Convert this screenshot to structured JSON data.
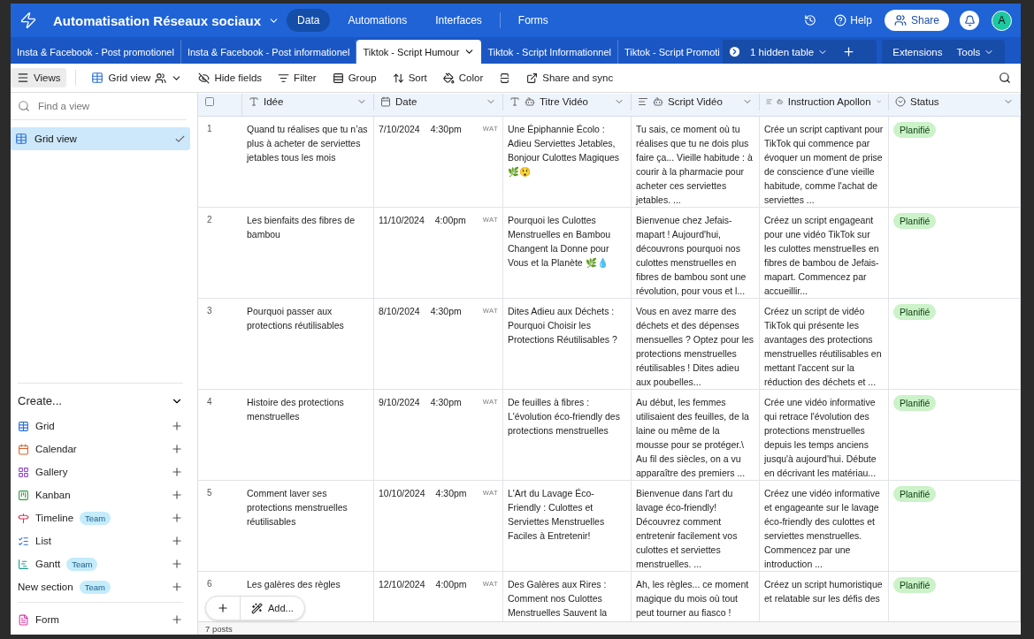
{
  "app": {
    "title": "Automatisation Réseaux sociaux"
  },
  "nav": [
    {
      "label": "Data",
      "selected": true
    },
    {
      "label": "Automations",
      "selected": false
    },
    {
      "label": "Interfaces",
      "selected": false
    },
    {
      "label": "Forms",
      "selected": false
    }
  ],
  "top_actions": {
    "help": "Help",
    "share": "Share",
    "avatar": "A"
  },
  "tables": [
    {
      "label": "Insta & Facebook - Post promotionel",
      "selected": false
    },
    {
      "label": "Insta & Facebook - Post informationel",
      "selected": false
    },
    {
      "label": "Tiktok - Script Humour",
      "selected": true
    },
    {
      "label": "Tiktok - Script Informationnel",
      "selected": false
    },
    {
      "label": "Tiktok - Script Promoti",
      "selected": false
    }
  ],
  "hidden_tables": "1 hidden table",
  "extensions": "Extensions",
  "tools": "Tools",
  "toolbar": {
    "views": "Views",
    "view_name": "Grid view",
    "items": [
      {
        "label": "Hide fields",
        "kind": "hide"
      },
      {
        "label": "Filter",
        "kind": "filter"
      },
      {
        "label": "Group",
        "kind": "group"
      },
      {
        "label": "Sort",
        "kind": "sort"
      },
      {
        "label": "Color",
        "kind": "color"
      },
      {
        "kind": "height"
      },
      {
        "label": "Share and sync",
        "kind": "share"
      }
    ]
  },
  "sidebar": {
    "search": {
      "placeholder": "Find a view"
    },
    "views": [
      {
        "label": "Grid view",
        "selected": true
      }
    ],
    "create_title": "Create...",
    "create_items": [
      {
        "label": "Grid",
        "kind": "grid"
      },
      {
        "label": "Calendar",
        "kind": "calendar"
      },
      {
        "label": "Gallery",
        "kind": "gallery"
      },
      {
        "label": "Kanban",
        "kind": "kanban"
      },
      {
        "label": "Timeline",
        "kind": "timeline",
        "badge": "Team"
      },
      {
        "label": "List",
        "kind": "list"
      },
      {
        "label": "Gantt",
        "kind": "gantt",
        "badge": "Team"
      },
      {
        "label": "New section",
        "kind": "section",
        "badge": "Team"
      },
      {
        "label": "Form",
        "kind": "form"
      }
    ]
  },
  "table": {
    "select_all": {
      "checked": false
    },
    "columns": [
      {
        "name": "Idée",
        "kind": "text"
      },
      {
        "name": "Date",
        "kind": "date"
      },
      {
        "name": "Titre Vidéo",
        "kind": "ai_text"
      },
      {
        "name": "Script Vidéo",
        "kind": "ai_long"
      },
      {
        "name": "Instruction Apollon",
        "kind": "ai_long"
      },
      {
        "name": "Status",
        "kind": "select"
      }
    ],
    "rows": [
      {
        "number": "1",
        "idee": "Quand tu réalises que tu n’as plus à acheter de serviettes jetables tous les mois",
        "date": "7/10/2024",
        "time": "4:30pm",
        "tz": "WAT",
        "titre": "Une Épiphannie Écolo : Adieu Serviettes Jetables, Bonjour Culottes Magiques 🌿😲",
        "script": "Tu sais, ce moment où tu réalises que tu ne dois plus faire ça... Vieille habitude : à courir à la pharmacie pour acheter ces serviettes jetables. ...",
        "instruction": "Crée un script captivant pour TikTok qui commence par évoquer un moment de prise de conscience d'une vieille habitude, comme l'achat de serviettes ...",
        "status": "Planifié"
      },
      {
        "number": "2",
        "idee": "Les bienfaits des fibres de bambou",
        "date": "11/10/2024",
        "time": "4:00pm",
        "tz": "WAT",
        "titre": "Pourquoi les Culottes Menstruelles en Bambou Changent la Donne pour Vous et la Planète 🌿💧",
        "script": "Bienvenue chez Jefais-mapart ! Aujourd'hui, découvrons pourquoi nos culottes menstruelles en fibres de bambou sont une révolution, pour vous et l...",
        "instruction": "Créez un script engageant pour une vidéo TikTok sur les culottes menstruelles en fibres de bambou de Jefais-mapart. Commencez par accueillir...",
        "status": "Planifié"
      },
      {
        "number": "3",
        "idee": "Pourquoi passer aux protections réutilisables",
        "date": "8/10/2024",
        "time": "4:30pm",
        "tz": "WAT",
        "titre": "Dites Adieu aux Déchets : Pourquoi Choisir les Protections Réutilisables ?",
        "script": "Vous en avez marre des déchets et des dépenses mensuelles ? Optez pour les protections menstruelles réutilisables ! Dites adieu aux poubelles...",
        "instruction": "Créez un script de vidéo TikTok qui présente les avantages des protections menstruelles réutilisables en mettant l'accent sur la réduction des déchets et ...",
        "status": "Planifié"
      },
      {
        "number": "4",
        "idee": "Histoire des protections menstruelles",
        "date": "9/10/2024",
        "time": "4:30pm",
        "tz": "WAT",
        "titre": "De feuilles à fibres : L'évolution éco-friendly des protections menstruelles",
        "script": "Au début, les femmes utilisaient des feuilles, de la laine ou même de la mousse pour se protéger.\\ Au fil des siècles, on a vu apparaître des premiers ...",
        "instruction": "Crée une vidéo informative qui retrace l'évolution des protections menstruelles depuis les temps anciens jusqu'à aujourd'hui. Débute en décrivant les matériau...",
        "status": "Planifié"
      },
      {
        "number": "5",
        "idee": "Comment laver ses protections menstruelles réutilisables",
        "date": "10/10/2024",
        "time": "4:30pm",
        "tz": "WAT",
        "titre": "L'Art du Lavage Éco-Friendly : Culottes et Serviettes Menstruelles Faciles à Entretenir!",
        "script": "Bienvenue dans l'art du lavage éco-friendly! Découvrez comment entretenir facilement vos culottes et serviettes menstruelles. ...",
        "instruction": "Créez une vidéo informative et engageante sur le lavage éco-friendly des culottes et serviettes menstruelles. Commencez par une introduction ...",
        "status": "Planifié"
      },
      {
        "number": "6",
        "idee": "Les galères des règles",
        "date": "12/10/2024",
        "time": "4:00pm",
        "tz": "WAT",
        "titre": "Des Galères aux Rires : Comment nos Culottes Menstruelles Sauvent la",
        "script": "Ah, les règles... ce moment magique du mois où tout peut tourner au fiasco !",
        "instruction": "Créez un script humoristique et relatable sur les défis des",
        "status": "Planifié"
      }
    ],
    "add_label": "Add...",
    "footer": "7 posts"
  }
}
